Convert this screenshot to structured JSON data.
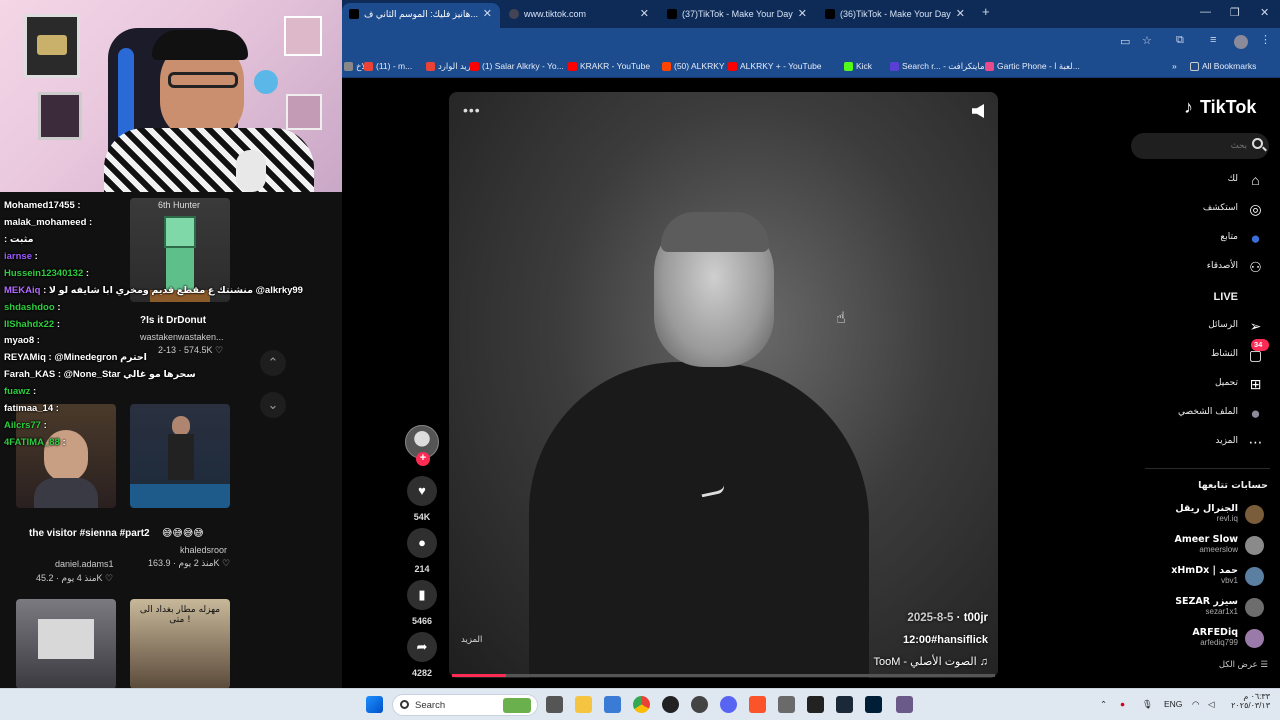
{
  "browser": {
    "tabs": [
      {
        "title": "هانيز فليك: الموسم الثاني ف..."
      },
      {
        "title": "www.tiktok.com"
      },
      {
        "title": "(37)TikTok - Make Your Day"
      },
      {
        "title": "(36)TikTok - Make Your Day"
      }
    ],
    "new_tab": "+",
    "bookmarks": [
      {
        "label": "الاخ",
        "color": "#888888"
      },
      {
        "label": "(11) - m...",
        "color": "#ea4335"
      },
      {
        "label": "البريد الوارد",
        "color": "#ea4335"
      },
      {
        "label": "(1) Salar Alkrky - Yo...",
        "color": "#ff0000"
      },
      {
        "label": "KRAKR - YouTube",
        "color": "#ff0000"
      },
      {
        "label": "(50) ALKRKY",
        "color": "#ff4500"
      },
      {
        "label": "ALKRKY + - YouTube",
        "color": "#ff0000"
      },
      {
        "label": "Kick",
        "color": "#53fc18"
      },
      {
        "label": "Search r... - مايتكرافت",
        "color": "#5a3fd6"
      },
      {
        "label": "Gartic Phone - لعبة ا...",
        "color": "#e94b8a"
      }
    ],
    "all_bookmarks": "All Bookmarks"
  },
  "stream_chat": [
    {
      "user": "Mohamed17455",
      "msg": ":",
      "color": "#ffffff"
    },
    {
      "user": "malak_mohameed",
      "msg": ":",
      "color": "#ffffff"
    },
    {
      "user": "",
      "msg": ": مثبت",
      "color": "#ff4d4d"
    },
    {
      "user": "iarnse",
      "msg": ":",
      "color": "#9b59ff"
    },
    {
      "user": "Hussein12340132",
      "msg": ":",
      "color": "#2ecc40"
    },
    {
      "user": "MEKAiq",
      "msg": ": منشنتك ع مقطع قديم ومخري ابا شايفه لو لا @alkrky99",
      "color": "#b46bff"
    },
    {
      "user": "shdashdoo",
      "msg": ":",
      "color": "#2ecc40"
    },
    {
      "user": "IIShahdx22",
      "msg": ":",
      "color": "#2ecc40"
    },
    {
      "user": "myao8",
      "msg": ":",
      "color": "#ffffff"
    },
    {
      "user": "REYAMiq",
      "msg": ": @Minedegron احترم",
      "color": "#ffffff"
    },
    {
      "user": "Farah_KAS",
      "msg": ": @None_Star سحرها مو غالي",
      "color": "#ffffff"
    },
    {
      "user": "fuawz",
      "msg": ":",
      "color": "#2ecc40"
    },
    {
      "user": "fatimaa_14",
      "msg": ":",
      "color": "#ffffff"
    },
    {
      "user": "Ailcrs77",
      "msg": ":",
      "color": "#2ecc40"
    },
    {
      "user": "4FATIMA_88",
      "msg": ":",
      "color": "#2ecc40"
    }
  ],
  "left_feed": {
    "cards": [
      {
        "title": "?Is it DrDonut",
        "sub": "wastakenwastaken...",
        "meta": "2-13 · 574.5K ♡",
        "overlay": "6th Hunter"
      },
      {
        "title": "the visitor #sienna #part2",
        "sub": "daniel.adams1",
        "meta": "منذ 4 يوم · 45.2K ♡"
      },
      {
        "title": "😅😅😅😅",
        "sub": "khaledsroor",
        "meta": "منذ 2 يوم · 163.9K ♡"
      },
      {
        "overlay": "مهزله مطار بغداد الى متى !"
      }
    ],
    "nav_up": "⌃",
    "nav_down": "⌄"
  },
  "video": {
    "author": "t00jr",
    "date": "2025-8-5",
    "caption": "12:00#hansiflick",
    "sound": "ToоM - الصوت الأصلي",
    "more": "المزيد",
    "progress_percent": 10
  },
  "actions": {
    "likes": "54K",
    "comments": "214",
    "saves": "5466",
    "shares": "4282"
  },
  "sidebar": {
    "logo": "TikTok",
    "search_placeholder": "بحث",
    "nav": [
      {
        "label": "لك",
        "icon": "home-icon"
      },
      {
        "label": "استكشف",
        "icon": "compass-icon"
      },
      {
        "label": "متابع",
        "icon": "avatar-icon"
      },
      {
        "label": "الأصدقاء",
        "icon": "friends-icon"
      },
      {
        "label": "LIVE",
        "icon": "live-icon"
      },
      {
        "label": "الرسائل",
        "icon": "send-icon"
      },
      {
        "label": "النشاط",
        "icon": "inbox-icon",
        "badge": "34"
      },
      {
        "label": "تحميل",
        "icon": "upload-icon"
      },
      {
        "label": "الملف الشخصي",
        "icon": "profile-icon"
      },
      {
        "label": "المزيد",
        "icon": "more-icon"
      }
    ],
    "following_title": "حسابات تتابعها",
    "following": [
      {
        "name": "الجنرال ريقل",
        "handle": "revl.iq",
        "color": "#7a5d3a"
      },
      {
        "name": "Ameer Slow",
        "handle": "ameerslow",
        "color": "#8a8a8a"
      },
      {
        "name": "xHmDx | حمد",
        "handle": "vbv1",
        "color": "#5a7fa0"
      },
      {
        "name": "SEZAR سيزر",
        "handle": "sezar1x1",
        "color": "#6d6d6d"
      },
      {
        "name": "ARFEDiq",
        "handle": "arfediq799",
        "color": "#9a7aa8"
      }
    ],
    "see_all": "عرض الكل"
  },
  "taskbar": {
    "search": "Search",
    "lang": "ENG",
    "time": "٠٦:٣٣ م",
    "date": "٢٠٢٥/٠٣/١٣"
  }
}
